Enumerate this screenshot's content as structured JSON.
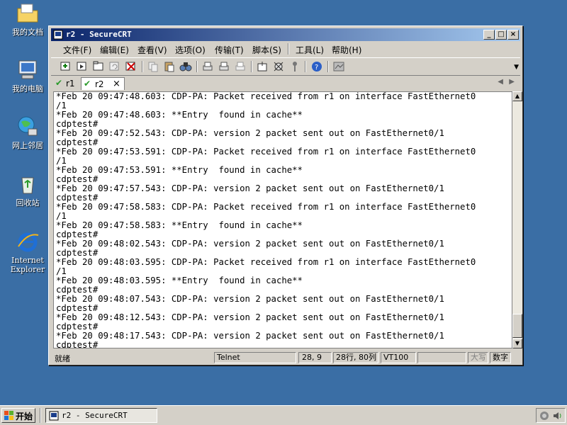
{
  "desktop": {
    "icons": [
      {
        "label": "我的文档"
      },
      {
        "label": "我的电脑"
      },
      {
        "label": "网上邻居"
      },
      {
        "label": "回收站"
      },
      {
        "label": "Internet Explorer"
      }
    ]
  },
  "window": {
    "title": "r2 - SecureCRT",
    "menu": [
      "文件(F)",
      "编辑(E)",
      "查看(V)",
      "选项(O)",
      "传输(T)",
      "脚本(S)",
      "工具(L)",
      "帮助(H)"
    ],
    "tabs": [
      {
        "label": "r1",
        "active": false
      },
      {
        "label": "r2",
        "active": true
      }
    ],
    "tab_close": "×"
  },
  "terminal": {
    "lines": [
      "*Feb 20 09:47:48.603: CDP-PA: Packet received from r1 on interface FastEthernet0",
      "/1",
      "*Feb 20 09:47:48.603: **Entry  found in cache**",
      "cdptest#",
      "*Feb 20 09:47:52.543: CDP-PA: version 2 packet sent out on FastEthernet0/1",
      "cdptest#",
      "*Feb 20 09:47:53.591: CDP-PA: Packet received from r1 on interface FastEthernet0",
      "/1",
      "*Feb 20 09:47:53.591: **Entry  found in cache**",
      "cdptest#",
      "*Feb 20 09:47:57.543: CDP-PA: version 2 packet sent out on FastEthernet0/1",
      "cdptest#",
      "*Feb 20 09:47:58.583: CDP-PA: Packet received from r1 on interface FastEthernet0",
      "/1",
      "*Feb 20 09:47:58.583: **Entry  found in cache**",
      "cdptest#",
      "*Feb 20 09:48:02.543: CDP-PA: version 2 packet sent out on FastEthernet0/1",
      "cdptest#",
      "*Feb 20 09:48:03.595: CDP-PA: Packet received from r1 on interface FastEthernet0",
      "/1",
      "*Feb 20 09:48:03.595: **Entry  found in cache**",
      "cdptest#",
      "*Feb 20 09:48:07.543: CDP-PA: version 2 packet sent out on FastEthernet0/1",
      "cdptest#",
      "*Feb 20 09:48:12.543: CDP-PA: version 2 packet sent out on FastEthernet0/1",
      "cdptest#",
      "*Feb 20 09:48:17.543: CDP-PA: version 2 packet sent out on FastEthernet0/1",
      "cdptest#"
    ]
  },
  "status": {
    "ready": "就绪",
    "protocol": "Telnet",
    "cursor": "28,  9",
    "size": "28行, 80列",
    "emulation": "VT100",
    "caps": "大写",
    "num": "数字"
  },
  "taskbar": {
    "start": "开始",
    "task": "r2 - SecureCRT"
  },
  "colors": {
    "desktop": "#3a6ea5",
    "title_start": "#0a246a",
    "title_end": "#a6caf0"
  }
}
